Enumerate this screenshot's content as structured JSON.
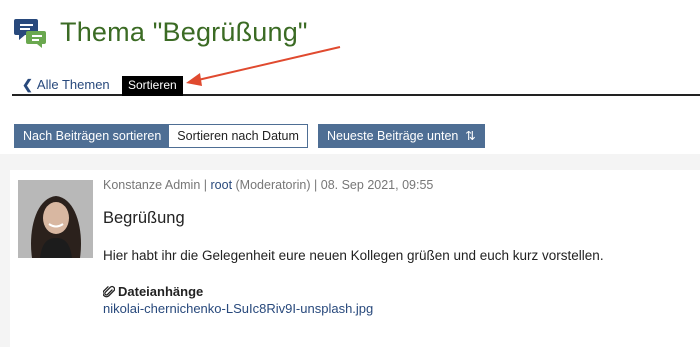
{
  "header": {
    "title": "Thema \"Begrüßung\"",
    "icon": "forum-chat-icon",
    "title_color": "#3b6b24"
  },
  "nav": {
    "back_label": "Alle Themen",
    "back_icon": "chevron-left-icon",
    "active_tab": "Sortieren"
  },
  "toolbar": {
    "sort_by_posts": "Nach Beiträgen sortieren",
    "sort_by_date": "Sortieren nach Datum",
    "newest_bottom": "Neueste Beiträge unten",
    "newest_icon": "sort-arrows-icon",
    "accent": "#4e6e94"
  },
  "post": {
    "author": "Konstanze Admin",
    "sep1": " | ",
    "username": "root",
    "role": " (Moderatorin)",
    "sep2": " | ",
    "date": "08. Sep 2021, 09:55",
    "title": "Begrüßung",
    "body": "Hier habt ihr die Gelegenheit eure neuen Kollegen grüßen und euch kurz vorstellen.",
    "attachments_label": "Dateianhänge",
    "attachments_icon": "paperclip-icon",
    "attachment_file": "nikolai-chernichenko-LSuIc8Riv9I-unsplash.jpg"
  },
  "annotation": {
    "arrow_color": "#e04a2f"
  }
}
